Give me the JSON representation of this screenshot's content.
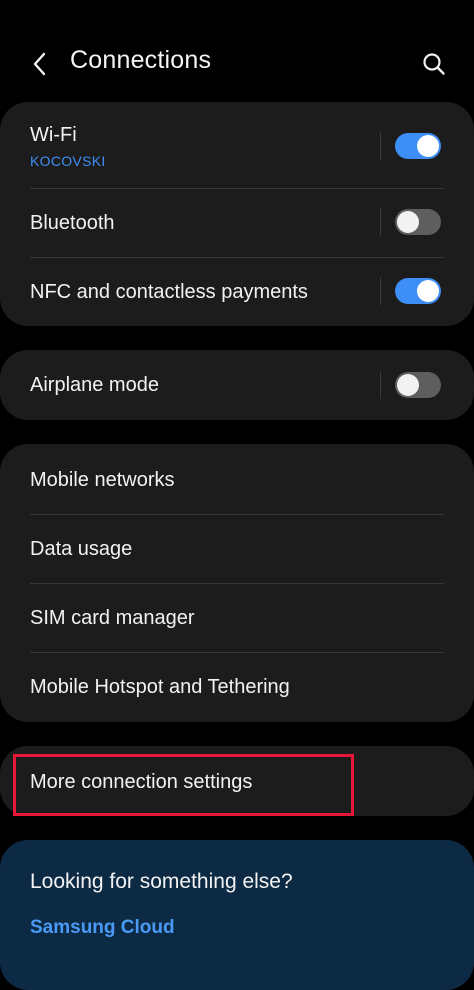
{
  "header": {
    "title": "Connections",
    "back_icon": "chevron-left-icon",
    "search_icon": "search-icon"
  },
  "toggles_group": {
    "items": [
      {
        "label": "Wi-Fi",
        "subtitle": "KOCOVSKI",
        "enabled": true
      },
      {
        "label": "Bluetooth",
        "enabled": false
      },
      {
        "label": "NFC and contactless payments",
        "enabled": true
      }
    ]
  },
  "airplane": {
    "label": "Airplane mode",
    "enabled": false
  },
  "network_group": {
    "items": [
      {
        "label": "Mobile networks"
      },
      {
        "label": "Data usage"
      },
      {
        "label": "SIM card manager"
      },
      {
        "label": "Mobile Hotspot and Tethering"
      }
    ]
  },
  "more": {
    "label": "More connection settings",
    "highlighted": true
  },
  "suggestions": {
    "title": "Looking for something else?",
    "link": "Samsung Cloud"
  },
  "colors": {
    "background": "#000000",
    "card": "#1c1c1c",
    "accent": "#3e8ef7",
    "suggestion_card": "#0d2a45",
    "highlight": "#e8173a"
  }
}
